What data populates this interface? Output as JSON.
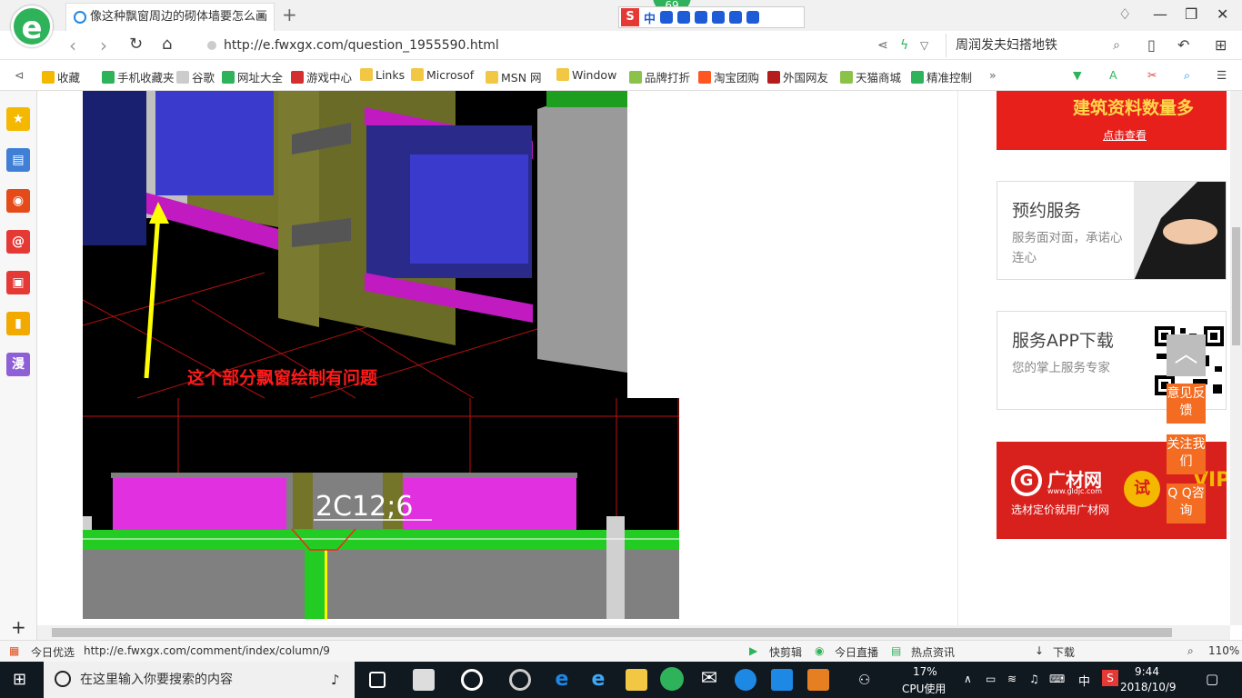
{
  "browser": {
    "tab_title": "像这种飘窗周边的砌体墙要怎么画",
    "badge_count": "69",
    "ime_label": "中",
    "url": "http://e.fwxgx.com/question_1955590.html",
    "search_text": "周润发夫妇搭地铁"
  },
  "favorites": [
    {
      "label": "收藏",
      "icon": "star-icon",
      "color": "#f5b800"
    },
    {
      "label": "手机收藏夹",
      "icon": "phone-icon",
      "color": "#2fb35a"
    },
    {
      "label": "谷歌",
      "icon": "page-icon",
      "color": "#cccccc"
    },
    {
      "label": "网址大全",
      "icon": "globe-icon",
      "color": "#2fb35a"
    },
    {
      "label": "游戏中心",
      "icon": "game-icon",
      "color": "#d32f2f"
    },
    {
      "label": "Links",
      "icon": "folder-icon",
      "color": "#f2c744"
    },
    {
      "label": "Microsof",
      "icon": "folder-icon",
      "color": "#f2c744"
    },
    {
      "label": "MSN 网",
      "icon": "folder-icon",
      "color": "#f2c744"
    },
    {
      "label": "Window",
      "icon": "folder-icon",
      "color": "#f2c744"
    },
    {
      "label": "品牌打折",
      "icon": "leaf-icon",
      "color": "#8bc34a"
    },
    {
      "label": "淘宝团购",
      "icon": "taobao-icon",
      "color": "#ff5722"
    },
    {
      "label": "外国网友",
      "icon": "flag-icon",
      "color": "#b71c1c"
    },
    {
      "label": "天猫商城",
      "icon": "leaf-icon",
      "color": "#8bc34a"
    },
    {
      "label": "精准控制",
      "icon": "chat-icon",
      "color": "#2fb35a"
    }
  ],
  "sidebar": {
    "icons": [
      {
        "name": "star-icon",
        "color": "#f5b800",
        "glyph": "★"
      },
      {
        "name": "news-icon",
        "color": "#3f7fd6",
        "glyph": "▤"
      },
      {
        "name": "weibo-icon",
        "color": "#e64a19",
        "glyph": "◉"
      },
      {
        "name": "mail-icon",
        "color": "#e53935",
        "glyph": "@"
      },
      {
        "name": "gamepad-icon",
        "color": "#e53935",
        "glyph": "▣"
      },
      {
        "name": "book-icon",
        "color": "#f2a900",
        "glyph": "▮"
      },
      {
        "name": "comic-icon",
        "color": "#8e5fd6",
        "glyph": "漫"
      }
    ],
    "add_label": "+"
  },
  "content": {
    "image_annotation": "这个部分飘窗绘制有问题",
    "rebar_label": "2C12;6"
  },
  "right_column": {
    "banner_top": {
      "title": "建筑资料数量多",
      "cta": "点击查看"
    },
    "card_booking": {
      "title": "预约服务",
      "desc": "服务面对面，承诺心连心"
    },
    "card_app": {
      "title": "服务APP下载",
      "desc": "您的掌上服务专家"
    },
    "banner_ad": {
      "brand": "广材网",
      "site": "www.gldjc.com",
      "slogan": "选材定价就用广材网",
      "trial": "试",
      "vip": "VIP"
    }
  },
  "floating": {
    "feedback": "意见反馈",
    "follow": "关注我们",
    "qq": "Q Q咨询"
  },
  "statusbar": {
    "left_label": "今日优选",
    "status_url": "http://e.fwxgx.com/comment/index/column/9",
    "items": [
      "快剪辑",
      "今日直播",
      "热点资讯",
      "下载"
    ],
    "zoom": "110%"
  },
  "taskbar": {
    "search_placeholder": "在这里输入你要搜索的内容",
    "cpu_percent": "17%",
    "cpu_label": "CPU使用",
    "ime": "中",
    "time": "9:44",
    "date": "2018/10/9"
  }
}
